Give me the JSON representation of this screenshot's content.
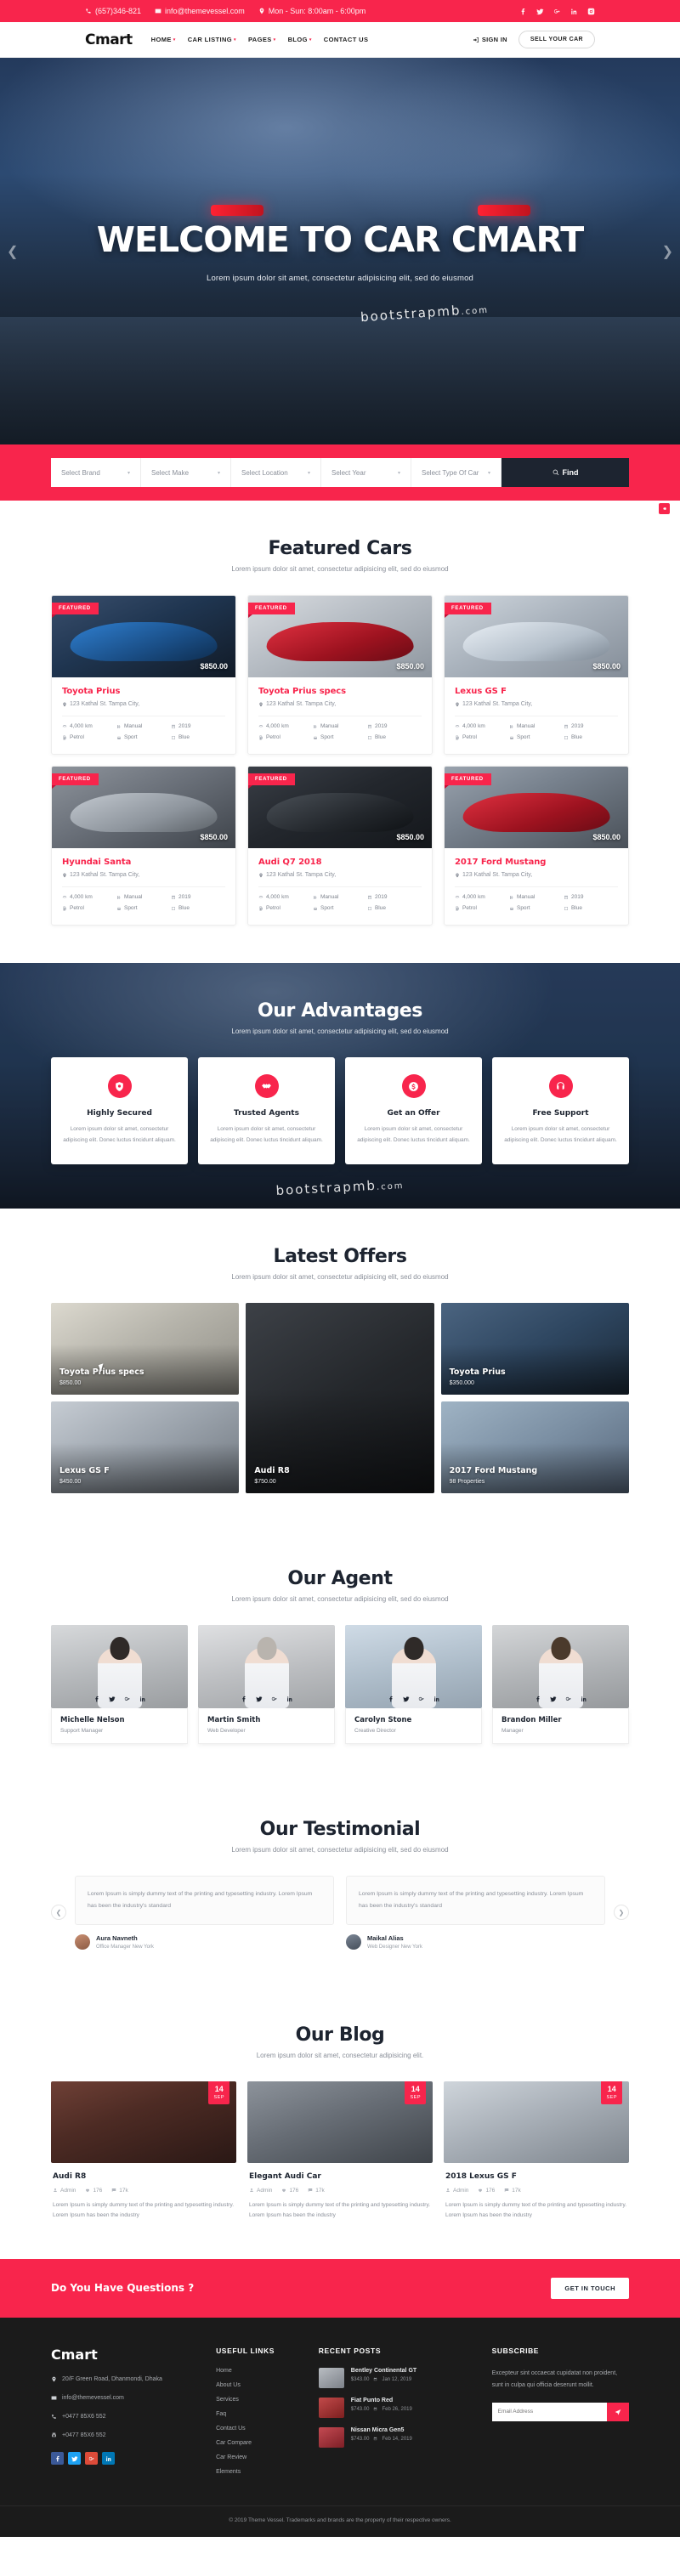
{
  "topbar": {
    "phone": "(657)346-821",
    "email": "info@themevessel.com",
    "hours": "Mon - Sun: 8:00am - 6:00pm",
    "socials": [
      "facebook-icon",
      "twitter-icon",
      "google-plus-icon",
      "linkedin-icon",
      "instagram-icon"
    ]
  },
  "nav": {
    "logo": "Cmart",
    "items": [
      {
        "label": "HOME",
        "caret": "▾"
      },
      {
        "label": "CAR LISTING",
        "caret": "▾"
      },
      {
        "label": "PAGES",
        "caret": "▾"
      },
      {
        "label": "BLOG",
        "caret": "▾"
      },
      {
        "label": "CONTACT US",
        "caret": ""
      }
    ],
    "signin": "SIGN IN",
    "sell_button": "SELL YOUR CAR"
  },
  "hero": {
    "title": "WELCOME TO CAR CMART",
    "subtitle": "Lorem ipsum dolor sit amet, consectetur adipisicing elit, sed do eiusmod",
    "watermark": "bootstrapmb",
    "watermark_tld": ".com",
    "prev": "❮",
    "next": "❯"
  },
  "search": {
    "fields": [
      {
        "placeholder": "Select Brand"
      },
      {
        "placeholder": "Select Make"
      },
      {
        "placeholder": "Select Location"
      },
      {
        "placeholder": "Select Year"
      },
      {
        "placeholder": "Select Type Of Car"
      }
    ],
    "button": "Find"
  },
  "featured": {
    "title": "Featured Cars",
    "subtitle": "Lorem ipsum dolor sit amet, consectetur adipisicing elit, sed do eiusmod",
    "badge": "FEATURED",
    "cars": [
      {
        "name": "Toyota Prius",
        "price": "$850.00",
        "location": "123 Kathal St. Tampa City,",
        "specs": [
          "4,000 km",
          "Manual",
          "2019",
          "Petrol",
          "Sport",
          "Blue"
        ]
      },
      {
        "name": "Toyota Prius specs",
        "price": "$850.00",
        "location": "123 Kathal St. Tampa City,",
        "specs": [
          "4,000 km",
          "Manual",
          "2019",
          "Petrol",
          "Sport",
          "Blue"
        ]
      },
      {
        "name": "Lexus GS F",
        "price": "$850.00",
        "location": "123 Kathal St. Tampa City,",
        "specs": [
          "4,000 km",
          "Manual",
          "2019",
          "Petrol",
          "Sport",
          "Blue"
        ]
      },
      {
        "name": "Hyundai Santa",
        "price": "$850.00",
        "location": "123 Kathal St. Tampa City,",
        "specs": [
          "4,000 km",
          "Manual",
          "2019",
          "Petrol",
          "Sport",
          "Blue"
        ]
      },
      {
        "name": "Audi Q7 2018",
        "price": "$850.00",
        "location": "123 Kathal St. Tampa City,",
        "specs": [
          "4,000 km",
          "Manual",
          "2019",
          "Petrol",
          "Sport",
          "Blue"
        ]
      },
      {
        "name": "2017 Ford Mustang",
        "price": "$850.00",
        "location": "123 Kathal St. Tampa City,",
        "specs": [
          "4,000 km",
          "Manual",
          "2019",
          "Petrol",
          "Sport",
          "Blue"
        ]
      }
    ]
  },
  "advantages": {
    "title": "Our Advantages",
    "subtitle": "Lorem ipsum dolor sit amet, consectetur adipisicing elit, sed do eiusmod",
    "watermark": "bootstrapmb",
    "watermark_tld": ".com",
    "items": [
      {
        "icon": "shield-icon",
        "title": "Highly Secured",
        "text": "Lorem ipsum dolor sit amet, consectetur adipiscing elit. Donec luctus tincidunt aliquam."
      },
      {
        "icon": "handshake-icon",
        "title": "Trusted Agents",
        "text": "Lorem ipsum dolor sit amet, consectetur adipiscing elit. Donec luctus tincidunt aliquam."
      },
      {
        "icon": "dollar-icon",
        "title": "Get an Offer",
        "text": "Lorem ipsum dolor sit amet, consectetur adipiscing elit. Donec luctus tincidunt aliquam."
      },
      {
        "icon": "support-icon",
        "title": "Free Support",
        "text": "Lorem ipsum dolor sit amet, consectetur adipiscing elit. Donec luctus tincidunt aliquam."
      }
    ]
  },
  "offers": {
    "title": "Latest Offers",
    "subtitle": "Lorem ipsum dolor sit amet, consectetur adipisicing elit, sed do eiusmod",
    "tiles": [
      {
        "name": "Toyota Prius specs",
        "price": "$850.00"
      },
      {
        "name": "Audi R8",
        "price": "$750.00"
      },
      {
        "name": "Toyota Prius",
        "price": "$350.000"
      },
      {
        "name": "Lexus GS F",
        "price": "$450.00"
      },
      {
        "name": "2017 Ford Mustang",
        "price": "98 Properties"
      }
    ]
  },
  "agents": {
    "title": "Our Agent",
    "subtitle": "Lorem ipsum dolor sit amet, consectetur adipisicing elit, sed do eiusmod",
    "list": [
      {
        "name": "Michelle Nelson",
        "role": "Support Manager"
      },
      {
        "name": "Martin Smith",
        "role": "Web Developer"
      },
      {
        "name": "Carolyn Stone",
        "role": "Creative Director"
      },
      {
        "name": "Brandon Miller",
        "role": "Manager"
      }
    ],
    "socials": [
      "facebook-icon",
      "twitter-icon",
      "google-plus-icon",
      "linkedin-icon"
    ]
  },
  "testimonial": {
    "title": "Our Testimonial",
    "subtitle": "Lorem ipsum dolor sit amet, consectetur adipisicing elit, sed do eiusmod",
    "prev": "❮",
    "next": "❯",
    "items": [
      {
        "quote": "Lorem Ipsum is simply dummy text of the printing and typesetting industry. Lorem Ipsum has been the industry's standard",
        "name": "Aura Navneth",
        "position": "Office Manager New York"
      },
      {
        "quote": "Lorem Ipsum is simply dummy text of the printing and typesetting industry. Lorem Ipsum has been the industry's standard",
        "name": "Maikal Alias",
        "position": "Web Designer New York"
      }
    ]
  },
  "blog": {
    "title": "Our Blog",
    "subtitle": "Lorem ipsum dolor sit amet, consectetur adipisicing elit.",
    "posts": [
      {
        "day": "14",
        "month": "SEP",
        "title": "Audi R8",
        "author": "Admin",
        "likes": "176",
        "comments": "17k",
        "text": "Lorem Ipsum is simply dummy text of the printing and typesetting industry. Lorem Ipsum has been the industry"
      },
      {
        "day": "14",
        "month": "SEP",
        "title": "Elegant Audi Car",
        "author": "Admin",
        "likes": "176",
        "comments": "17k",
        "text": "Lorem Ipsum is simply dummy text of the printing and typesetting industry. Lorem Ipsum has been the industry"
      },
      {
        "day": "14",
        "month": "SEP",
        "title": "2018 Lexus GS F",
        "author": "Admin",
        "likes": "176",
        "comments": "17k",
        "text": "Lorem Ipsum is simply dummy text of the printing and typesetting industry. Lorem Ipsum has been the industry"
      }
    ]
  },
  "cta": {
    "heading": "Do You Have Questions ?",
    "button": "GET IN TOUCH"
  },
  "footer": {
    "logo": "Cmart",
    "address": "20/F Green Road, Dhanmondi, Dhaka",
    "email": "info@themevessel.com",
    "phone": "+0477 85X6 552",
    "fax": "+0477 85X6 552",
    "socials": [
      "facebook-icon",
      "twitter-icon",
      "google-plus-icon",
      "linkedin-icon"
    ],
    "useful_links_title": "USEFUL LINKS",
    "useful_links": [
      "Home",
      "About Us",
      "Services",
      "Faq",
      "Contact Us",
      "Car Compare",
      "Car Review",
      "Elements"
    ],
    "recent_posts_title": "RECENT POSTS",
    "recent_posts": [
      {
        "title": "Bentley Continental GT",
        "price": "$343.00",
        "date": "Jan 12, 2019"
      },
      {
        "title": "Fiat Punto Red",
        "price": "$743.00",
        "date": "Feb 26, 2019"
      },
      {
        "title": "Nissan Micra Gen5",
        "price": "$743.00",
        "date": "Feb 14, 2019"
      }
    ],
    "subscribe_title": "SUBSCRIBE",
    "subscribe_text": "Excepteur sint occaecat cupidatat non proident, sunt in culpa qui officia deserunt mollit.",
    "email_placeholder": "Email Address",
    "copyright": "© 2019 Theme Vessel. Trademarks and brands are the property of their respective owners."
  },
  "colors": {
    "accent": "#f8254c",
    "dark": "#1d2430",
    "footer_bg": "#1b1b1b"
  }
}
